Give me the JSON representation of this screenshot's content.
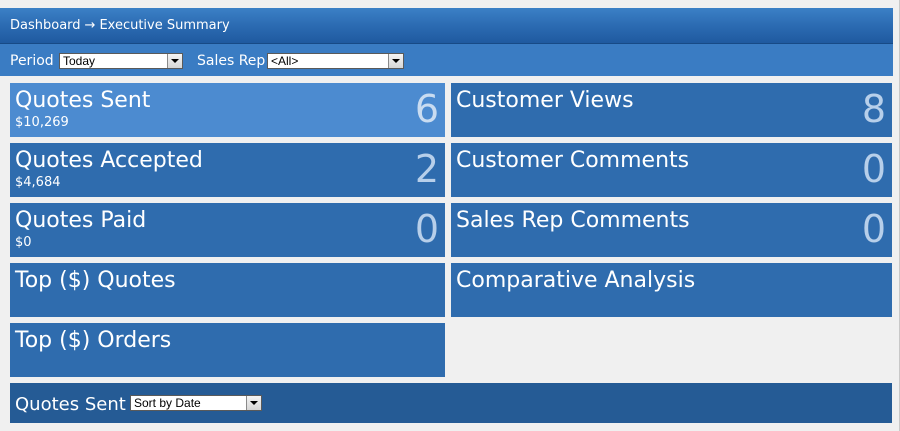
{
  "breadcrumb": {
    "root": "Dashboard",
    "separator": "→",
    "current": "Executive Summary"
  },
  "filters": {
    "period_label": "Period",
    "period_value": "Today",
    "sales_rep_label": "Sales Rep",
    "sales_rep_value": "<All>"
  },
  "tiles": [
    {
      "title": "Quotes Sent",
      "subtitle": "$10,269",
      "count": "6",
      "highlighted": true
    },
    {
      "title": "Customer Views",
      "subtitle": "",
      "count": "8"
    },
    {
      "title": "Quotes Accepted",
      "subtitle": "$4,684",
      "count": "2"
    },
    {
      "title": "Customer Comments",
      "subtitle": "",
      "count": "0"
    },
    {
      "title": "Quotes Paid",
      "subtitle": "$0",
      "count": "0"
    },
    {
      "title": "Sales Rep Comments",
      "subtitle": "",
      "count": "0"
    },
    {
      "title": "Top ($) Quotes",
      "subtitle": "",
      "count": ""
    },
    {
      "title": "Comparative Analysis",
      "subtitle": "",
      "count": ""
    },
    {
      "title": "Top ($) Orders",
      "subtitle": "",
      "count": ""
    }
  ],
  "section": {
    "title": "Quotes Sent",
    "sort_value": "Sort by Date"
  },
  "colors": {
    "header": "#2a69b0",
    "filter_bar": "#3a7cc3",
    "tile": "#2f6cae",
    "tile_highlight": "#4c8bd0",
    "section_bar": "#255b95",
    "background": "#f0f0f0"
  },
  "icons": {
    "dropdown": "chevron-down-icon"
  }
}
